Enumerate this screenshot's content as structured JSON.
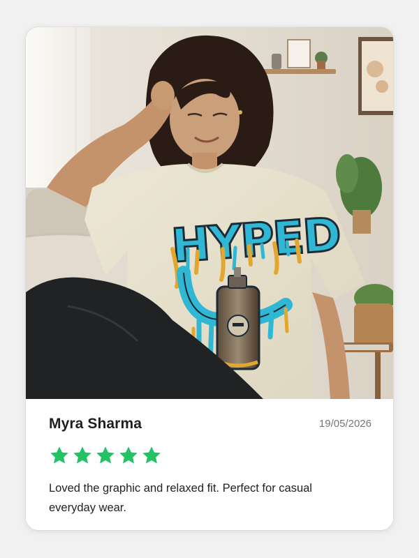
{
  "review": {
    "image_alt": "Woman wearing an oversized cream graphic tee with blue dripping HYPED lettering and a spray can",
    "graphic_text": "HYPED",
    "reviewer_name": "Myra Sharma",
    "date": "19/05/2026",
    "rating": 5,
    "rating_max": 5,
    "text": "Loved the graphic and relaxed fit. Perfect for casual everyday wear."
  },
  "colors": {
    "star": "#22c265",
    "page_bg": "#f1f1f1",
    "card_bg": "#ffffff",
    "name": "#1f1f1f",
    "date": "#777777",
    "text": "#222222"
  },
  "icons": {
    "star": "star-icon"
  }
}
